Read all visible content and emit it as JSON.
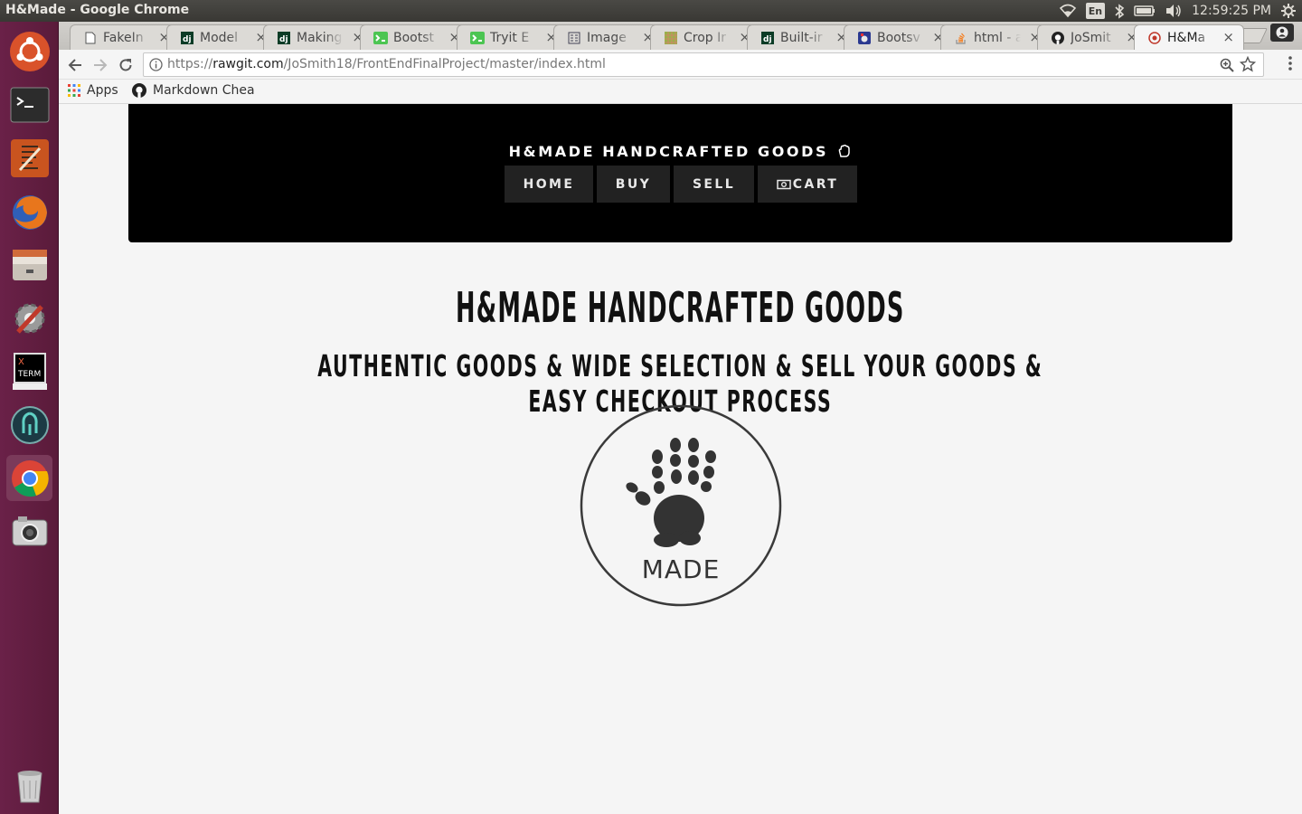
{
  "desktop": {
    "window_title": "H&Made - Google Chrome",
    "keyboard_layout": "En",
    "clock": "12:59:25 PM"
  },
  "browser": {
    "tabs": [
      {
        "label": "FakeIn",
        "icon": "page-icon"
      },
      {
        "label": "Model",
        "icon": "django-icon"
      },
      {
        "label": "Making",
        "icon": "django-icon"
      },
      {
        "label": "Bootst",
        "icon": "tryit-icon"
      },
      {
        "label": "Tryit E",
        "icon": "tryit-icon"
      },
      {
        "label": "Image",
        "icon": "image-doc-icon"
      },
      {
        "label": "Crop Ir",
        "icon": "grid-icon"
      },
      {
        "label": "Built-ir",
        "icon": "django-icon"
      },
      {
        "label": "Bootsv",
        "icon": "bootsnipp-icon"
      },
      {
        "label": "html - a",
        "icon": "stackoverflow-icon"
      },
      {
        "label": "JoSmit",
        "icon": "github-icon"
      },
      {
        "label": "H&Ma",
        "icon": "hmade-icon",
        "active": true
      }
    ],
    "url_scheme": "https://",
    "url_host": "rawgit.com",
    "url_path": "/JoSmith18/FrontEndFinalProject/master/index.html",
    "bookmarks": [
      {
        "label": "Apps",
        "icon": "apps-grid-icon"
      },
      {
        "label": "Markdown Chea",
        "icon": "github-icon"
      }
    ]
  },
  "site": {
    "brand": "H&MADE HANDCRAFTED GOODS",
    "brand_icon": "hand-outline-icon",
    "nav": {
      "home": "HOME",
      "buy": "BUY",
      "sell": "SELL",
      "cart": "CART",
      "cart_icon": "money-icon"
    },
    "heading": "H&MADE HANDCRAFTED GOODS",
    "tagline": "AUTHENTIC GOODS & WIDE SELECTION & SELL YOUR GOODS & EASY CHECKOUT PROCESS",
    "logo_text": "MADE"
  }
}
